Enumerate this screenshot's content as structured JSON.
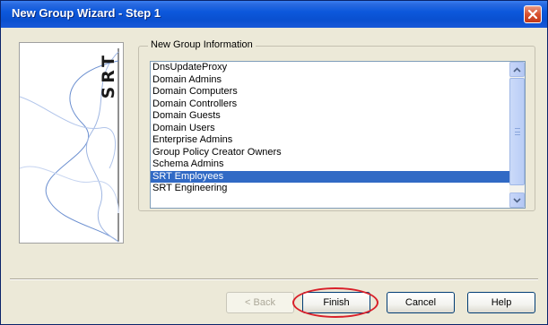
{
  "window": {
    "title": "New Group Wizard - Step 1",
    "close_icon": "close-icon"
  },
  "side_panel": {
    "logo_text": "SRT"
  },
  "group_info": {
    "legend": "New Group Information",
    "items": [
      {
        "label": "DnsUpdateProxy",
        "selected": false
      },
      {
        "label": "Domain Admins",
        "selected": false
      },
      {
        "label": "Domain Computers",
        "selected": false
      },
      {
        "label": "Domain Controllers",
        "selected": false
      },
      {
        "label": "Domain Guests",
        "selected": false
      },
      {
        "label": "Domain Users",
        "selected": false
      },
      {
        "label": "Enterprise Admins",
        "selected": false
      },
      {
        "label": "Group Policy Creator Owners",
        "selected": false
      },
      {
        "label": "Schema Admins",
        "selected": false
      },
      {
        "label": "SRT Employees",
        "selected": true
      },
      {
        "label": "SRT Engineering",
        "selected": false
      }
    ]
  },
  "buttons": {
    "back": "< Back",
    "finish": "Finish",
    "cancel": "Cancel",
    "help": "Help"
  },
  "colors": {
    "selection": "#316ac5",
    "titlebar": "#0a50d0",
    "highlight": "#d9202a"
  }
}
